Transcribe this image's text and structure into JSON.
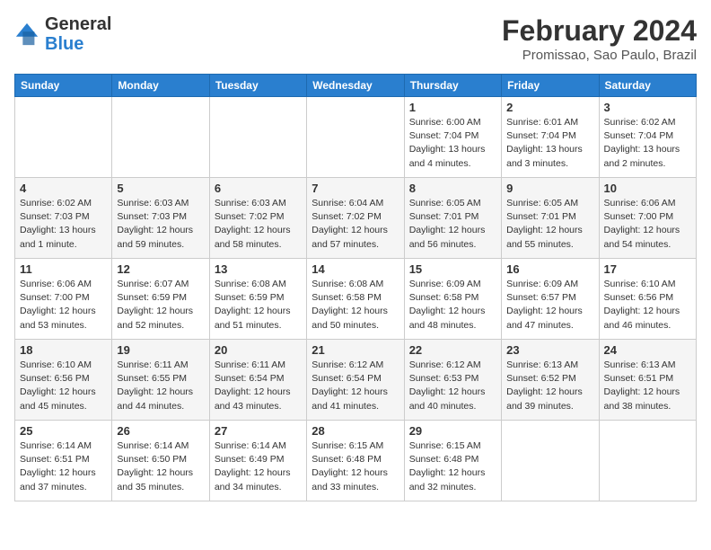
{
  "header": {
    "logo_general": "General",
    "logo_blue": "Blue",
    "month_year": "February 2024",
    "location": "Promissao, Sao Paulo, Brazil"
  },
  "days_of_week": [
    "Sunday",
    "Monday",
    "Tuesday",
    "Wednesday",
    "Thursday",
    "Friday",
    "Saturday"
  ],
  "weeks": [
    [
      {
        "day": "",
        "info": ""
      },
      {
        "day": "",
        "info": ""
      },
      {
        "day": "",
        "info": ""
      },
      {
        "day": "",
        "info": ""
      },
      {
        "day": "1",
        "info": "Sunrise: 6:00 AM\nSunset: 7:04 PM\nDaylight: 13 hours\nand 4 minutes."
      },
      {
        "day": "2",
        "info": "Sunrise: 6:01 AM\nSunset: 7:04 PM\nDaylight: 13 hours\nand 3 minutes."
      },
      {
        "day": "3",
        "info": "Sunrise: 6:02 AM\nSunset: 7:04 PM\nDaylight: 13 hours\nand 2 minutes."
      }
    ],
    [
      {
        "day": "4",
        "info": "Sunrise: 6:02 AM\nSunset: 7:03 PM\nDaylight: 13 hours\nand 1 minute."
      },
      {
        "day": "5",
        "info": "Sunrise: 6:03 AM\nSunset: 7:03 PM\nDaylight: 12 hours\nand 59 minutes."
      },
      {
        "day": "6",
        "info": "Sunrise: 6:03 AM\nSunset: 7:02 PM\nDaylight: 12 hours\nand 58 minutes."
      },
      {
        "day": "7",
        "info": "Sunrise: 6:04 AM\nSunset: 7:02 PM\nDaylight: 12 hours\nand 57 minutes."
      },
      {
        "day": "8",
        "info": "Sunrise: 6:05 AM\nSunset: 7:01 PM\nDaylight: 12 hours\nand 56 minutes."
      },
      {
        "day": "9",
        "info": "Sunrise: 6:05 AM\nSunset: 7:01 PM\nDaylight: 12 hours\nand 55 minutes."
      },
      {
        "day": "10",
        "info": "Sunrise: 6:06 AM\nSunset: 7:00 PM\nDaylight: 12 hours\nand 54 minutes."
      }
    ],
    [
      {
        "day": "11",
        "info": "Sunrise: 6:06 AM\nSunset: 7:00 PM\nDaylight: 12 hours\nand 53 minutes."
      },
      {
        "day": "12",
        "info": "Sunrise: 6:07 AM\nSunset: 6:59 PM\nDaylight: 12 hours\nand 52 minutes."
      },
      {
        "day": "13",
        "info": "Sunrise: 6:08 AM\nSunset: 6:59 PM\nDaylight: 12 hours\nand 51 minutes."
      },
      {
        "day": "14",
        "info": "Sunrise: 6:08 AM\nSunset: 6:58 PM\nDaylight: 12 hours\nand 50 minutes."
      },
      {
        "day": "15",
        "info": "Sunrise: 6:09 AM\nSunset: 6:58 PM\nDaylight: 12 hours\nand 48 minutes."
      },
      {
        "day": "16",
        "info": "Sunrise: 6:09 AM\nSunset: 6:57 PM\nDaylight: 12 hours\nand 47 minutes."
      },
      {
        "day": "17",
        "info": "Sunrise: 6:10 AM\nSunset: 6:56 PM\nDaylight: 12 hours\nand 46 minutes."
      }
    ],
    [
      {
        "day": "18",
        "info": "Sunrise: 6:10 AM\nSunset: 6:56 PM\nDaylight: 12 hours\nand 45 minutes."
      },
      {
        "day": "19",
        "info": "Sunrise: 6:11 AM\nSunset: 6:55 PM\nDaylight: 12 hours\nand 44 minutes."
      },
      {
        "day": "20",
        "info": "Sunrise: 6:11 AM\nSunset: 6:54 PM\nDaylight: 12 hours\nand 43 minutes."
      },
      {
        "day": "21",
        "info": "Sunrise: 6:12 AM\nSunset: 6:54 PM\nDaylight: 12 hours\nand 41 minutes."
      },
      {
        "day": "22",
        "info": "Sunrise: 6:12 AM\nSunset: 6:53 PM\nDaylight: 12 hours\nand 40 minutes."
      },
      {
        "day": "23",
        "info": "Sunrise: 6:13 AM\nSunset: 6:52 PM\nDaylight: 12 hours\nand 39 minutes."
      },
      {
        "day": "24",
        "info": "Sunrise: 6:13 AM\nSunset: 6:51 PM\nDaylight: 12 hours\nand 38 minutes."
      }
    ],
    [
      {
        "day": "25",
        "info": "Sunrise: 6:14 AM\nSunset: 6:51 PM\nDaylight: 12 hours\nand 37 minutes."
      },
      {
        "day": "26",
        "info": "Sunrise: 6:14 AM\nSunset: 6:50 PM\nDaylight: 12 hours\nand 35 minutes."
      },
      {
        "day": "27",
        "info": "Sunrise: 6:14 AM\nSunset: 6:49 PM\nDaylight: 12 hours\nand 34 minutes."
      },
      {
        "day": "28",
        "info": "Sunrise: 6:15 AM\nSunset: 6:48 PM\nDaylight: 12 hours\nand 33 minutes."
      },
      {
        "day": "29",
        "info": "Sunrise: 6:15 AM\nSunset: 6:48 PM\nDaylight: 12 hours\nand 32 minutes."
      },
      {
        "day": "",
        "info": ""
      },
      {
        "day": "",
        "info": ""
      }
    ]
  ]
}
